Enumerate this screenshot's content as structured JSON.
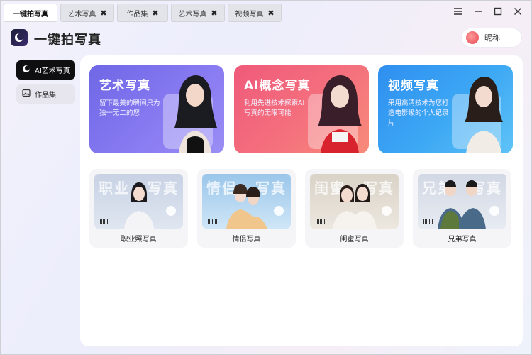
{
  "tabs": [
    {
      "label": "一键拍写真",
      "active": true
    },
    {
      "label": "艺术写真",
      "closable": true
    },
    {
      "label": "作品集",
      "closable": true
    },
    {
      "label": "艺术写真",
      "closable": true
    },
    {
      "label": "视频写真",
      "closable": true
    }
  ],
  "tab_close_glyph": "✖",
  "header": {
    "title": "一键拍写真",
    "user_name": "昵称"
  },
  "sidebar": {
    "items": [
      {
        "label": "AI艺术写真",
        "icon": "ai-portrait-icon",
        "active": true
      },
      {
        "label": "作品集",
        "icon": "gallery-icon",
        "active": false
      }
    ]
  },
  "feature_cards": [
    {
      "title": "艺术写真",
      "desc": "留下最美的瞬间只为独一无二的您",
      "color": "#7a70ec"
    },
    {
      "title": "AI概念写真",
      "desc": "利用先进技术探索AI写真的无限可能",
      "color": "#f2637c"
    },
    {
      "title": "视频写真",
      "desc": "采用高清技术为您打造电影级的个人纪录片",
      "color": "#3aa2f2"
    }
  ],
  "category_cards": [
    {
      "label": "职业照写真",
      "thumb_text": [
        "职业",
        "写真"
      ]
    },
    {
      "label": "情侣写真",
      "thumb_text": [
        "情侣",
        "写真"
      ]
    },
    {
      "label": "闺蜜写真",
      "thumb_text": [
        "闺蜜",
        "写真"
      ]
    },
    {
      "label": "兄弟写真",
      "thumb_text": [
        "兄弟",
        "写真"
      ]
    }
  ]
}
